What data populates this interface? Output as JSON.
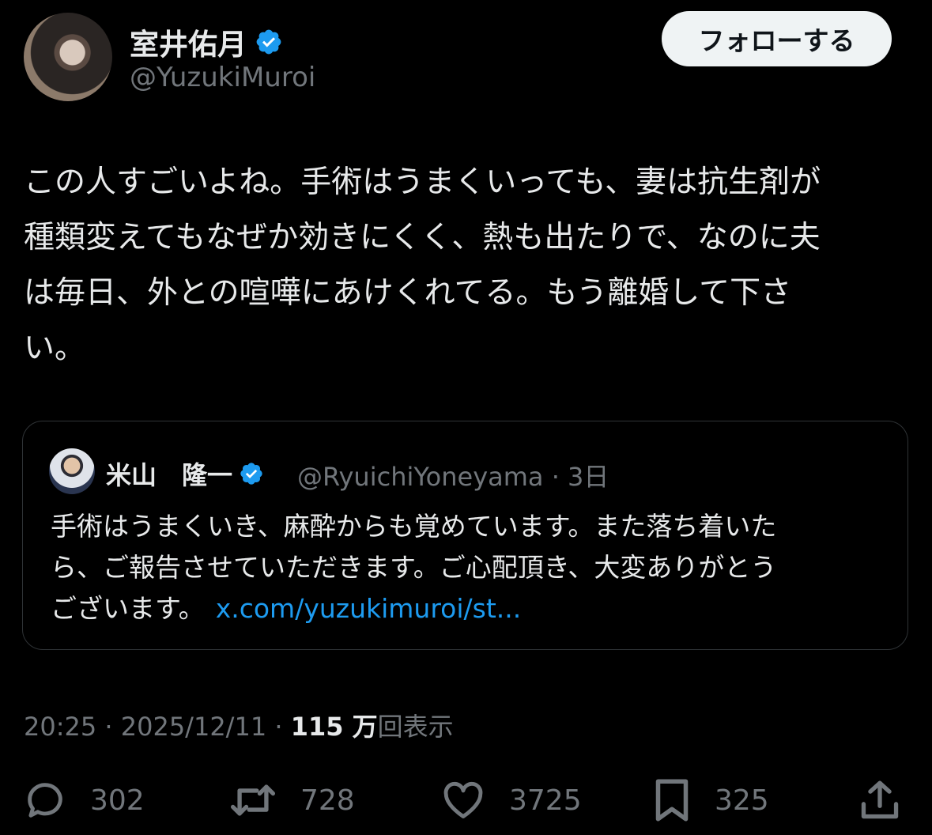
{
  "author": {
    "display_name": "室井佑月",
    "handle": "@YuzukiMuroi",
    "verified": true
  },
  "follow_label": "フォローする",
  "tweet_lines": [
    "この人すごいよね。手術はうまくいっても、妻は抗生剤が",
    "種類変えてもなぜか効きにくく、熱も出たりで、なのに夫",
    "は毎日、外との喧嘩にあけくれてる。もう離婚して下さ",
    "い。"
  ],
  "quote": {
    "display_name": "米山　隆一",
    "handle": "@RyuichiYoneyama",
    "separator": "·",
    "age": "3日",
    "lines": [
      "手術はうまくいき、麻酔からも覚めています。また落ち着いた",
      "ら、ご報告させていただきます。ご心配頂き、大変ありがとう",
      "ございます。"
    ],
    "link_text": "x.com/yuzukimuroi/st..."
  },
  "meta": {
    "time": "20:25",
    "sep1": "·",
    "date": "2025/12/11",
    "sep2": "·",
    "views_count": "115 万",
    "views_label": "回表示"
  },
  "actions": {
    "replies": "302",
    "reposts": "728",
    "likes": "3725",
    "bookmarks": "325"
  },
  "colors": {
    "background": "#000000",
    "text": "#e7e9ea",
    "muted": "#71767b",
    "link": "#1d9bf0",
    "verified_badge": "#1d9bf0",
    "border": "#2f3336"
  },
  "icons": {
    "verified": "verified-badge-icon",
    "reply": "speech-bubble-icon",
    "repost": "repost-arrows-icon",
    "like": "heart-icon",
    "bookmark": "bookmark-icon",
    "share": "share-upload-icon"
  }
}
